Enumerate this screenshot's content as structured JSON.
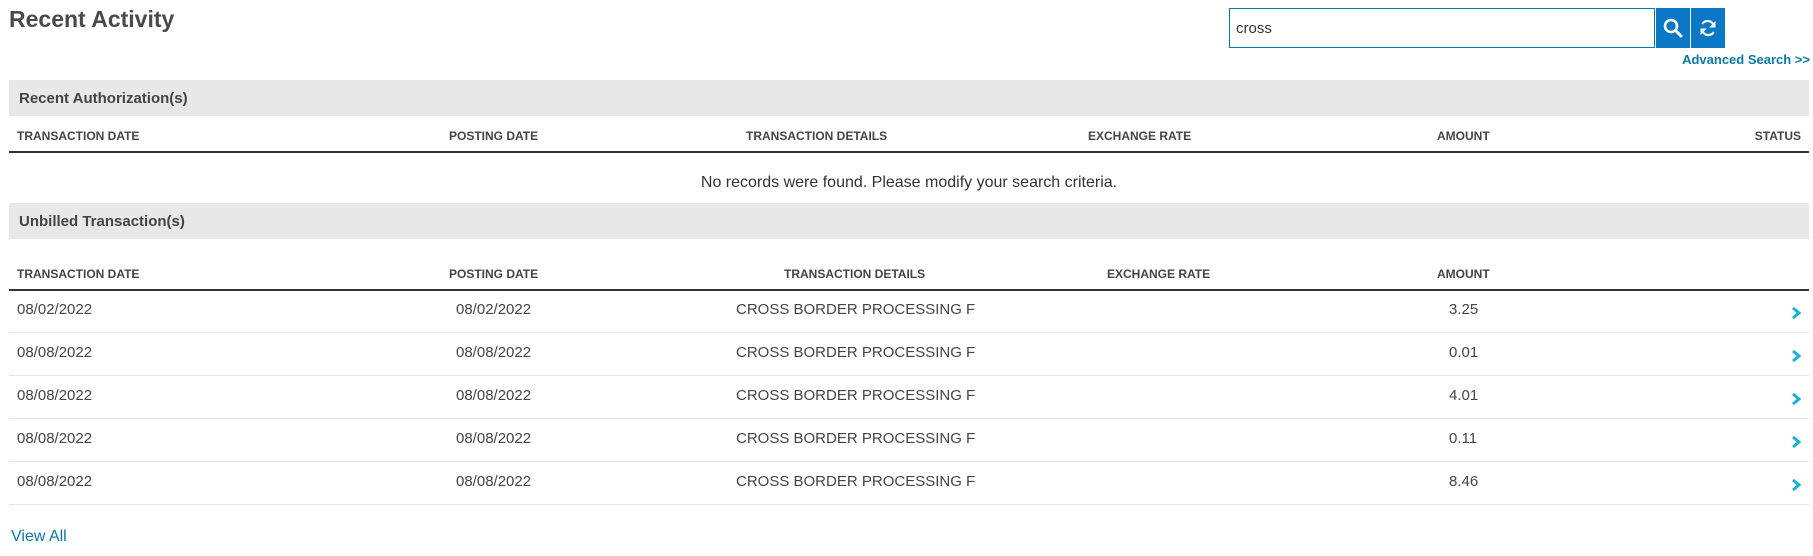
{
  "page": {
    "title": "Recent Activity"
  },
  "search": {
    "value": "cross",
    "placeholder": "",
    "search_icon": "search-icon",
    "refresh_icon": "refresh-icon",
    "advanced_link": "Advanced Search >>"
  },
  "colors": {
    "accent": "#0a78c5",
    "link": "#0a78a8",
    "section_bg": "#e8e8e8",
    "chevron": "#1ab0d8"
  },
  "authorizations": {
    "title": "Recent Authorization(s)",
    "columns": [
      "TRANSACTION DATE",
      "POSTING DATE",
      "TRANSACTION DETAILS",
      "EXCHANGE RATE",
      "AMOUNT",
      "STATUS"
    ],
    "empty_message": "No records were found. Please modify your search criteria."
  },
  "unbilled": {
    "title": "Unbilled Transaction(s)",
    "columns": [
      "TRANSACTION DATE",
      "POSTING DATE",
      "TRANSACTION DETAILS",
      "EXCHANGE RATE",
      "AMOUNT"
    ],
    "rows": [
      {
        "transaction_date": "08/02/2022",
        "posting_date": "08/02/2022",
        "details": "CROSS BORDER PROCESSING F",
        "exchange_rate": "",
        "amount": "3.25"
      },
      {
        "transaction_date": "08/08/2022",
        "posting_date": "08/08/2022",
        "details": "CROSS BORDER PROCESSING F",
        "exchange_rate": "",
        "amount": "0.01"
      },
      {
        "transaction_date": "08/08/2022",
        "posting_date": "08/08/2022",
        "details": "CROSS BORDER PROCESSING F",
        "exchange_rate": "",
        "amount": "4.01"
      },
      {
        "transaction_date": "08/08/2022",
        "posting_date": "08/08/2022",
        "details": "CROSS BORDER PROCESSING F",
        "exchange_rate": "",
        "amount": "0.11"
      },
      {
        "transaction_date": "08/08/2022",
        "posting_date": "08/08/2022",
        "details": "CROSS BORDER PROCESSING F",
        "exchange_rate": "",
        "amount": "8.46"
      }
    ],
    "row_icon": "chevron-right-icon",
    "view_all": "View All"
  }
}
